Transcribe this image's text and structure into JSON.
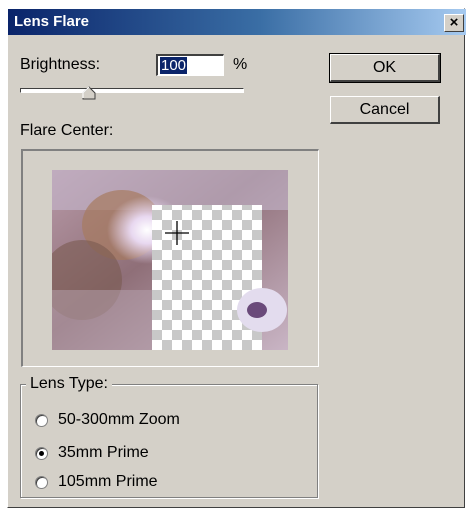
{
  "window": {
    "title": "Lens Flare",
    "close_glyph": "×"
  },
  "brightness": {
    "label": "Brightness:",
    "value": "100",
    "unit": "%",
    "slider_level_percent": 33
  },
  "buttons": {
    "ok": "OK",
    "cancel": "Cancel"
  },
  "flare_center": {
    "label": "Flare Center:"
  },
  "lens_type": {
    "legend": "Lens Type:",
    "options": [
      {
        "label": "50-300mm Zoom",
        "selected": false
      },
      {
        "label": "35mm Prime",
        "selected": true
      },
      {
        "label": "105mm Prime",
        "selected": false
      }
    ]
  },
  "colors": {
    "titlebar_start": "#0a246a",
    "dialog_bg": "#d4d0c8",
    "selection": "#0a246a"
  },
  "icons": {
    "crosshair": "crosshair-icon",
    "slider_thumb": "slider-thumb-icon",
    "close": "close-icon"
  }
}
